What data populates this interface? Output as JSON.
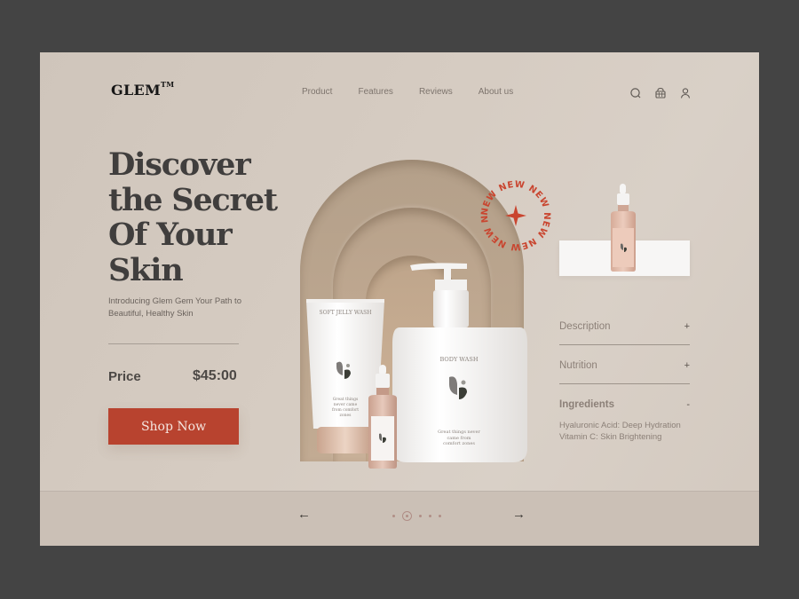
{
  "brand": {
    "name": "GLEM",
    "trademark": "TM"
  },
  "nav": {
    "items": [
      {
        "label": "Product"
      },
      {
        "label": "Features"
      },
      {
        "label": "Reviews"
      },
      {
        "label": "About us"
      }
    ]
  },
  "header_icons": [
    "search-icon",
    "basket-icon",
    "user-icon"
  ],
  "hero": {
    "headline_lines": [
      "Discover",
      "the Secret",
      "Of Your",
      "Skin"
    ],
    "subtitle": "Introducing Glem Gem Your Path to Beautiful, Healthy Skin",
    "price_label": "Price",
    "price_value": "$45:00",
    "cta_label": "Shop Now"
  },
  "badge": {
    "text": "NEW NEW NEW NEW NEW NEW NEW NEW ",
    "color": "#c9452f"
  },
  "products": {
    "tube": {
      "name": "SOFT JELLY WASH",
      "tagline": "Great things never came from comfort zones"
    },
    "pump": {
      "name": "BODY WASH",
      "tagline": "Great things never came from comfort zones"
    }
  },
  "accordion": [
    {
      "title": "Description",
      "sign": "+",
      "open": false
    },
    {
      "title": "Nutrition",
      "sign": "+",
      "open": false
    },
    {
      "title": "Ingredients",
      "sign": "-",
      "open": true,
      "body": [
        "Hyaluronic Acid: Deep Hydration",
        "Vitamin C: Skin Brightening"
      ]
    }
  ],
  "pagination": {
    "prev": "←",
    "next": "→",
    "total": 5,
    "active": 2
  },
  "colors": {
    "accent": "#b8432f",
    "page_bg": "#d3c9bf",
    "outer_bg": "#444444",
    "heading": "#403e3d"
  }
}
